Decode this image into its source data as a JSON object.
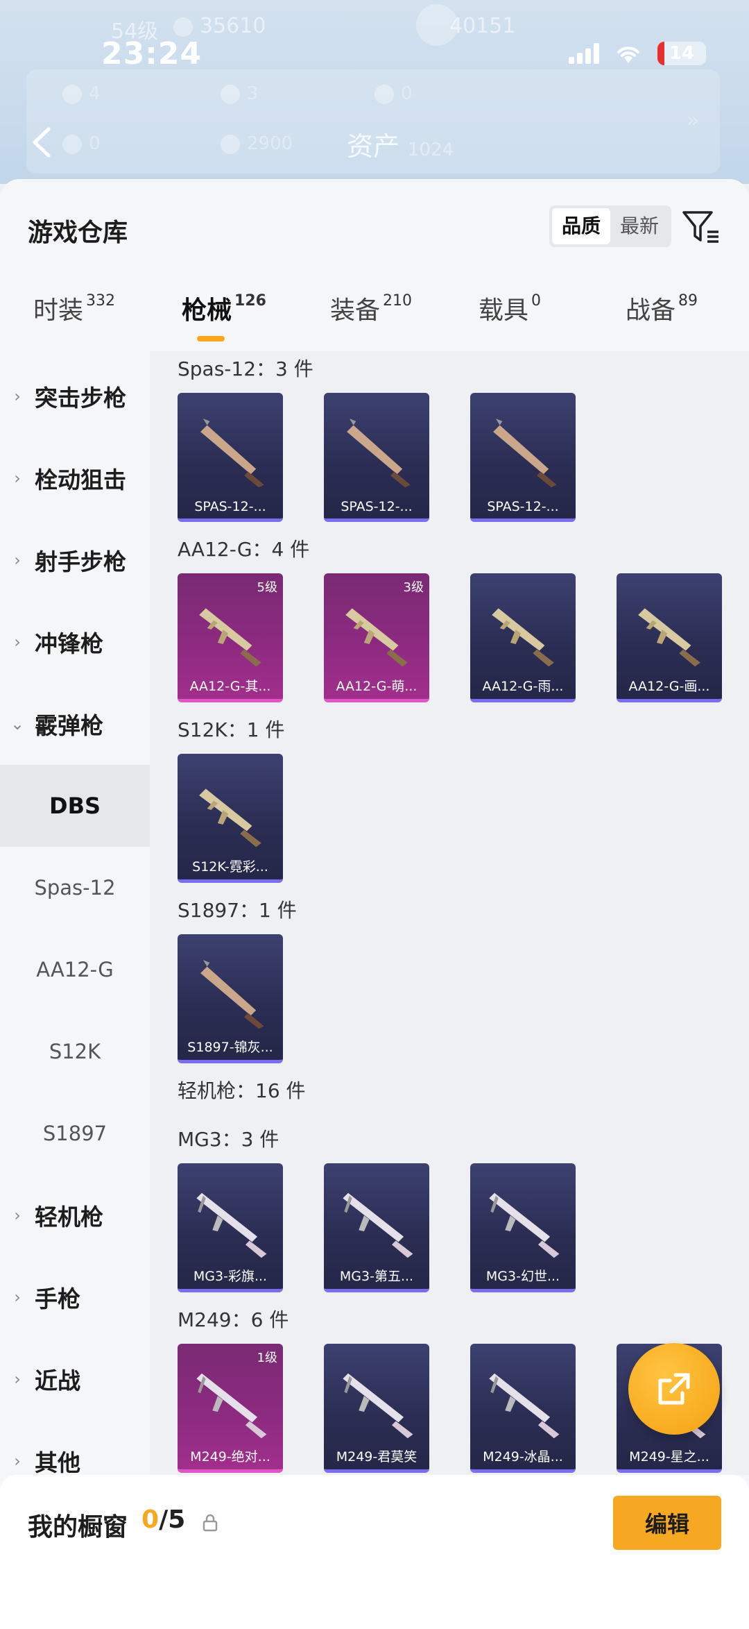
{
  "status_bar": {
    "time": "23:24",
    "battery": "14"
  },
  "background": {
    "left_level": "54级",
    "left_coins": "35610",
    "right_coins": "40151",
    "stat_1": "4",
    "stat_2": "3",
    "stat_3": "0",
    "stat_4": "0",
    "stat_5": "2900",
    "asset_label": "资产",
    "asset_value": "1024"
  },
  "sheet": {
    "title": "游戏仓库",
    "sort_options": [
      "品质",
      "最新"
    ],
    "sort_active": "品质"
  },
  "tabs": [
    {
      "label": "时装",
      "count": "332"
    },
    {
      "label": "枪械",
      "count": "126"
    },
    {
      "label": "装备",
      "count": "210"
    },
    {
      "label": "载具",
      "count": "0"
    },
    {
      "label": "战备",
      "count": "89"
    }
  ],
  "sidebar": {
    "categories": [
      "突击步枪",
      "栓动狙击",
      "射手步枪",
      "冲锋枪",
      "霰弹枪",
      "轻机枪",
      "手枪",
      "近战",
      "其他"
    ],
    "subitems": [
      "DBS",
      "Spas-12",
      "AA12-G",
      "S12K",
      "S1897"
    ]
  },
  "sections": {
    "spas": {
      "header": "Spas-12：3 件",
      "items": [
        {
          "name": "SPAS-12-...",
          "rarity": "blue"
        },
        {
          "name": "SPAS-12-...",
          "rarity": "blue"
        },
        {
          "name": "SPAS-12-...",
          "rarity": "blue"
        }
      ]
    },
    "aa12": {
      "header": "AA12-G：4 件",
      "items": [
        {
          "name": "AA12-G-其...",
          "rarity": "pink",
          "level": "5级"
        },
        {
          "name": "AA12-G-萌...",
          "rarity": "pink",
          "level": "3级"
        },
        {
          "name": "AA12-G-雨...",
          "rarity": "blue"
        },
        {
          "name": "AA12-G-画...",
          "rarity": "blue"
        }
      ]
    },
    "s12k": {
      "header": "S12K：1 件",
      "items": [
        {
          "name": "S12K-霓彩...",
          "rarity": "blue"
        }
      ]
    },
    "s1897": {
      "header": "S1897：1 件",
      "items": [
        {
          "name": "S1897-锦灰...",
          "rarity": "blue"
        }
      ]
    },
    "lmg": {
      "header": "轻机枪：16 件"
    },
    "mg3": {
      "header": "MG3：3 件",
      "items": [
        {
          "name": "MG3-彩旗...",
          "rarity": "blue"
        },
        {
          "name": "MG3-第五...",
          "rarity": "blue"
        },
        {
          "name": "MG3-幻世...",
          "rarity": "blue"
        }
      ]
    },
    "m249": {
      "header": "M249：6 件",
      "items": [
        {
          "name": "M249-绝对...",
          "rarity": "pink",
          "level": "1级"
        },
        {
          "name": "M249-君莫笑",
          "rarity": "blue"
        },
        {
          "name": "M249-冰晶...",
          "rarity": "blue"
        },
        {
          "name": "M249-星之...",
          "rarity": "blue"
        }
      ]
    }
  },
  "footer": {
    "title": "我的橱窗",
    "count_current": "0",
    "count_total": "/5",
    "edit_label": "编辑"
  },
  "colors": {
    "accent": "#f7a823",
    "blue_card": "#2a2c52",
    "pink_card": "#8c2a80"
  }
}
